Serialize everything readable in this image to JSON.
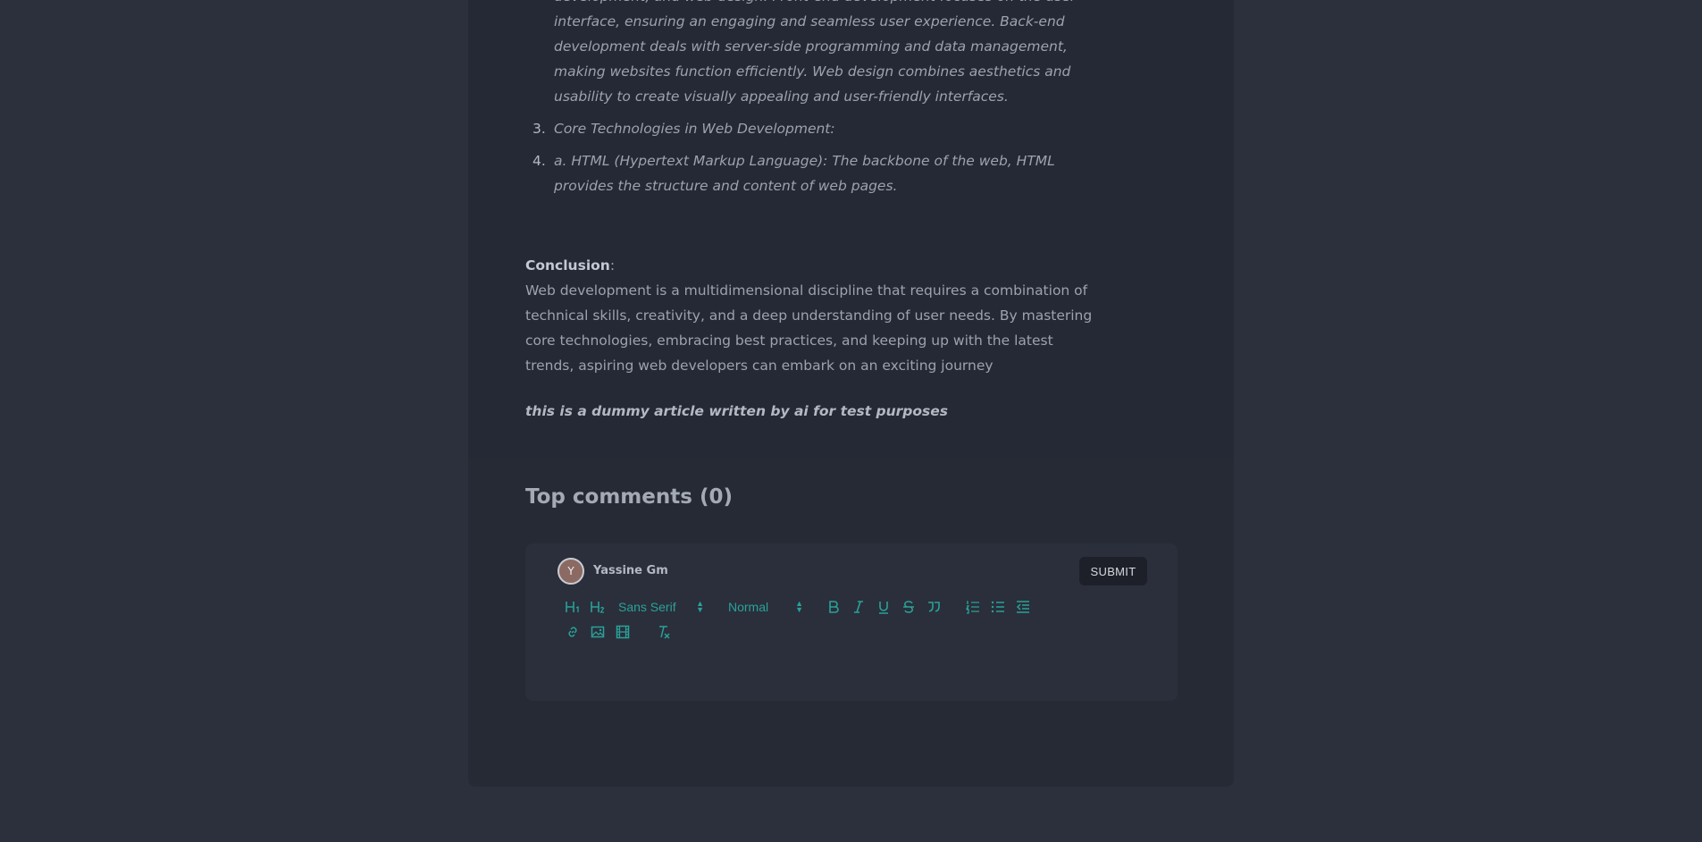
{
  "article": {
    "item2_text": "development, and web design. Front-end development focuses on the user interface, ensuring an engaging and seamless user experience. Back-end development deals with server-side programming and data management, making websites function efficiently. Web design combines aesthetics and usability to create visually appealing and user-friendly interfaces.",
    "item3_num": "3.",
    "item3_text": "Core Technologies in Web Development:",
    "item4_num": "4.",
    "item4_text": "a. HTML (Hypertext Markup Language): The backbone of the web, HTML provides the structure and content of web pages.",
    "conclusion_head": "Conclusion",
    "conclusion_colon": ":",
    "conclusion_text": "Web development is a multidimensional discipline that requires a combination of technical skills, creativity, and a deep understanding of user needs. By mastering core technologies, embracing best practices, and keeping up with the latest trends, aspiring web developers can embark on an exciting journey",
    "dummy_note": "this is a dummy article written by ai for test purposes"
  },
  "comments": {
    "title": "Top comments (0)",
    "avatar_letter": "Y",
    "username": "Yassine Gm",
    "submit_label": "SUBMIT",
    "font_picker_value": "Sans Serif",
    "size_picker_value": "Normal",
    "toolbar_icons": [
      "h1-icon",
      "h2-icon",
      "bold-icon",
      "italic-icon",
      "underline-icon",
      "strike-icon",
      "blockquote-icon",
      "ordered-list-icon",
      "bullet-list-icon",
      "outdent-icon",
      "link-icon",
      "image-icon",
      "video-icon",
      "clear-format-icon"
    ]
  },
  "colors": {
    "accent": "#2aa198",
    "background": "#2b303c",
    "panel": "#252935"
  }
}
